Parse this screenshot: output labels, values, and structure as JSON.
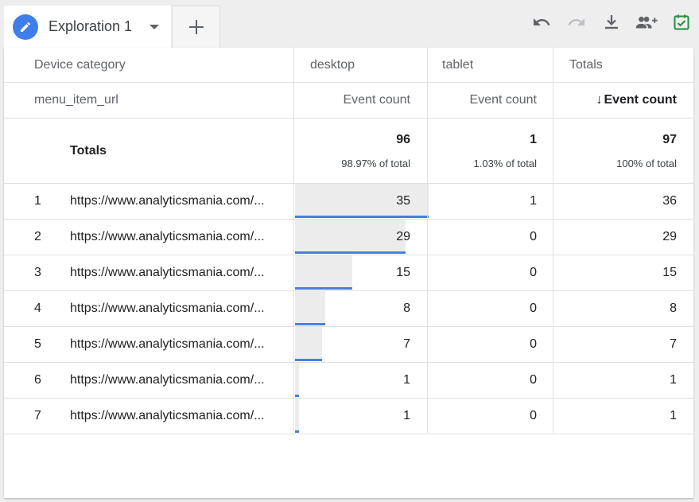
{
  "tab": {
    "label": "Exploration 1"
  },
  "colors": {
    "accent": "#3f7ee8",
    "bar": "#4a7fe0",
    "save_check": "#1e8e3e"
  },
  "toolbar": {
    "icons": [
      "undo-icon",
      "redo-icon",
      "download-icon",
      "share-users-icon",
      "save-check-icon"
    ]
  },
  "table": {
    "dimension_header": "Device category",
    "row_dimension": "menu_item_url",
    "columns": [
      {
        "name": "desktop",
        "metric": "Event count",
        "total": "96",
        "pct": "98.97% of total"
      },
      {
        "name": "tablet",
        "metric": "Event count",
        "total": "1",
        "pct": "1.03% of total"
      },
      {
        "name": "Totals",
        "metric": "Event count",
        "sort_arrow": "↓",
        "total": "97",
        "pct": "100% of total"
      }
    ],
    "totals_label": "Totals",
    "rows": [
      {
        "index": "1",
        "url": "https://www.analyticsmania.com/...",
        "desktop": "35",
        "tablet": "1",
        "total": "36",
        "desktop_share": 1.0
      },
      {
        "index": "2",
        "url": "https://www.analyticsmania.com/...",
        "desktop": "29",
        "tablet": "0",
        "total": "29",
        "desktop_share": 0.8286
      },
      {
        "index": "3",
        "url": "https://www.analyticsmania.com/...",
        "desktop": "15",
        "tablet": "0",
        "total": "15",
        "desktop_share": 0.4286
      },
      {
        "index": "4",
        "url": "https://www.analyticsmania.com/...",
        "desktop": "8",
        "tablet": "0",
        "total": "8",
        "desktop_share": 0.2286
      },
      {
        "index": "5",
        "url": "https://www.analyticsmania.com/...",
        "desktop": "7",
        "tablet": "0",
        "total": "7",
        "desktop_share": 0.2
      },
      {
        "index": "6",
        "url": "https://www.analyticsmania.com/...",
        "desktop": "1",
        "tablet": "0",
        "total": "1",
        "desktop_share": 0.0286
      },
      {
        "index": "7",
        "url": "https://www.analyticsmania.com/...",
        "desktop": "1",
        "tablet": "0",
        "total": "1",
        "desktop_share": 0.0286
      }
    ]
  }
}
